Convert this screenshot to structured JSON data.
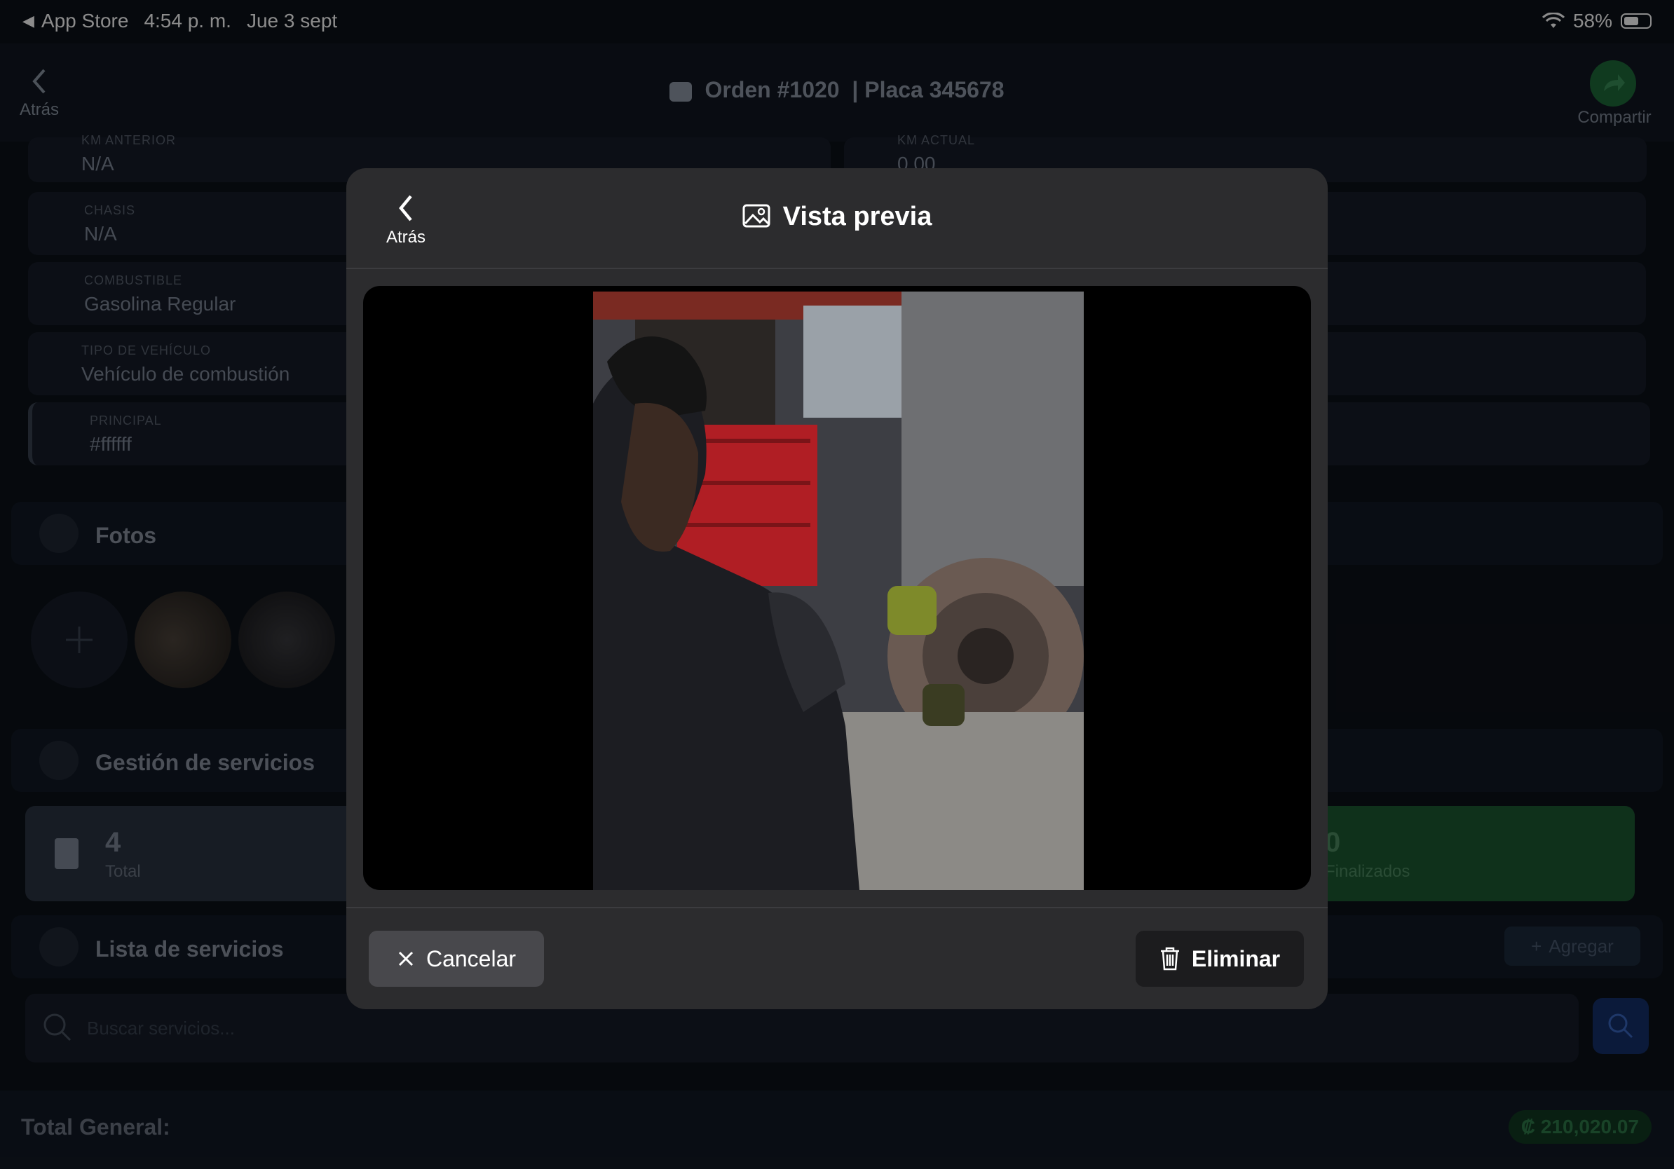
{
  "status_bar": {
    "back_app": "App Store",
    "time": "4:54 p. m.",
    "date": "Jue 3 sept",
    "battery_percent": "58%",
    "battery_level": 0.58
  },
  "nav": {
    "back_label": "Atrás",
    "order": "Orden #1020",
    "plate": "| Placa 345678",
    "share_label": "Compartir"
  },
  "fields": [
    {
      "label": "KM ANTERIOR",
      "value": "N/A"
    },
    {
      "label": "KM ACTUAL",
      "value": "0.00"
    },
    {
      "label": "CHASIS",
      "value": "N/A"
    },
    {
      "label": "COMBUSTIBLE",
      "value": "Gasolina Regular"
    },
    {
      "label": "TIPO DE VEHÍCULO",
      "value": "Vehículo de combustión"
    },
    {
      "label": "PRINCIPAL",
      "value": "#ffffff"
    }
  ],
  "photos_section": {
    "title": "Fotos"
  },
  "services": {
    "title": "Gestión de servicios",
    "total_count": "4",
    "total_label": "Total",
    "finished_count": "0",
    "finished_label": "Finalizados"
  },
  "service_list": {
    "title": "Lista de servicios",
    "add_label": "Agregar",
    "search_placeholder": "Buscar servicios..."
  },
  "footer": {
    "total_label": "Total General:",
    "total_value": "₡ 210,020.07"
  },
  "modal": {
    "back_label": "Atrás",
    "title": "Vista previa",
    "cancel_label": "Cancelar",
    "delete_label": "Eliminar"
  },
  "colors": {
    "background": "#0c1118",
    "modal": "#2c2c2e",
    "green_accent": "#1e6b3a"
  }
}
